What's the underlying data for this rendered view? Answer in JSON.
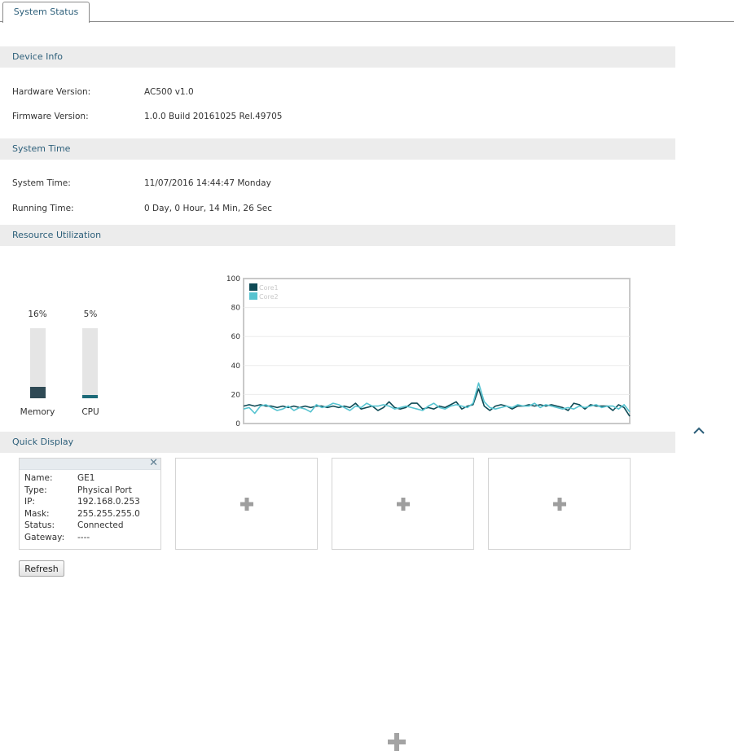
{
  "tabs": [
    {
      "label": "System Status"
    }
  ],
  "device_info": {
    "title": "Device Info",
    "hardware_label": "Hardware Version:",
    "hardware_value": "AC500 v1.0",
    "firmware_label": "Firmware Version:",
    "firmware_value": "1.0.0 Build 20161025 Rel.49705"
  },
  "system_time": {
    "title": "System Time",
    "time_label": "System Time:",
    "time_value": "11/07/2016 14:44:47 Monday",
    "running_label": "Running Time:",
    "running_value": "0 Day, 0 Hour, 14 Min, 26 Sec"
  },
  "resource": {
    "title": "Resource Utilization",
    "memory": {
      "label": "Memory",
      "percent_text": "16%",
      "value": 16,
      "color": "#2f4a55"
    },
    "cpu": {
      "label": "CPU",
      "percent_text": "5%",
      "value": 5,
      "color": "#1c6a78"
    }
  },
  "chart_data": {
    "type": "line",
    "ylim": [
      0,
      100
    ],
    "yticks": [
      0,
      20,
      40,
      60,
      80,
      100
    ],
    "grid": true,
    "legend": "top-left",
    "x": [
      1,
      2,
      3,
      4,
      5,
      6,
      7,
      8,
      9,
      10,
      11,
      12,
      13,
      14,
      15,
      16,
      17,
      18,
      19,
      20,
      21,
      22,
      23,
      24,
      25,
      26,
      27,
      28,
      29,
      30,
      31,
      32,
      33,
      34,
      35,
      36,
      37,
      38,
      39,
      40,
      41,
      42,
      43,
      44,
      45,
      46,
      47,
      48,
      49,
      50,
      51,
      52,
      53,
      54,
      55,
      56,
      57,
      58,
      59,
      60,
      61,
      62,
      63,
      64,
      65,
      66,
      67,
      68,
      69,
      70
    ],
    "series": [
      {
        "name": "Core1",
        "color": "#0e4a55",
        "values": [
          12,
          13,
          12,
          13,
          12,
          12,
          11,
          12,
          11,
          12,
          11,
          12,
          11,
          12,
          12,
          11,
          12,
          11,
          12,
          11,
          14,
          10,
          11,
          12,
          9,
          11,
          15,
          11,
          10,
          11,
          14,
          14,
          10,
          11,
          10,
          12,
          11,
          13,
          15,
          10,
          12,
          13,
          24,
          12,
          9,
          12,
          13,
          12,
          10,
          12,
          12,
          13,
          12,
          13,
          12,
          13,
          12,
          11,
          9,
          14,
          13,
          10,
          13,
          12,
          12,
          12,
          9,
          13,
          11,
          5
        ]
      },
      {
        "name": "Core2",
        "color": "#56c3d0",
        "values": [
          10,
          11,
          7,
          12,
          13,
          11,
          9,
          10,
          12,
          9,
          11,
          10,
          8,
          13,
          11,
          12,
          14,
          13,
          11,
          9,
          12,
          11,
          14,
          12,
          12,
          13,
          12,
          10,
          11,
          12,
          11,
          10,
          9,
          12,
          14,
          11,
          10,
          12,
          13,
          12,
          11,
          14,
          28,
          15,
          11,
          10,
          11,
          12,
          11,
          13,
          12,
          12,
          14,
          11,
          13,
          12,
          11,
          10,
          11,
          10,
          12,
          11,
          12,
          13,
          11,
          12,
          12,
          10,
          13,
          8
        ]
      }
    ]
  },
  "quick_display": {
    "title": "Quick Display",
    "card": {
      "rows": [
        {
          "label": "Name:",
          "value": "GE1"
        },
        {
          "label": "Type:",
          "value": "Physical Port"
        },
        {
          "label": "IP:",
          "value": "192.168.0.253"
        },
        {
          "label": "Mask:",
          "value": "255.255.255.0"
        },
        {
          "label": "Status:",
          "value": "Connected"
        },
        {
          "label": "Gateway:",
          "value": "----"
        }
      ]
    },
    "refresh_label": "Refresh"
  },
  "icons": {
    "close": "close-icon",
    "add": "plus-icon",
    "scroll_top": "chevron-up-icon"
  }
}
